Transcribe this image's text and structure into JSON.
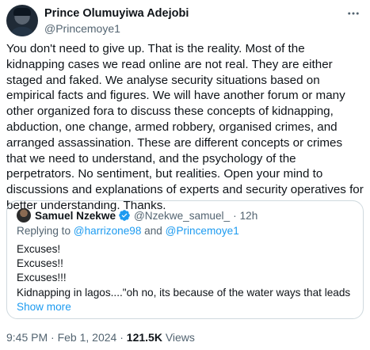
{
  "tweet": {
    "author_name": "Prince Olumuyiwa Adejobi",
    "author_handle": "@Princemoye1",
    "icons": {
      "more": "more-horizontal-icon"
    },
    "text": "You don't need to give up. That is the reality. Most of the kidnapping cases we read online are not real. They are either staged and faked. We analyse security situations based on empirical facts and figures. We will have another forum or many other organized fora to discuss these concepts of kidnapping, abduction, one change, armed robbery, organised crimes, and arranged assassination. These are different concepts or crimes that we need to understand, and the psychology of the perpetrators. No sentiment, but realities. Open your mind to discussions and explanations of experts and security operatives for better understanding. Thanks."
  },
  "quoted": {
    "author_name": "Samuel Nzekwe",
    "author_handle": "@Nzekwe_samuel_",
    "separator": "·",
    "time_ago": "12h",
    "verified_icon": "verified-badge-icon",
    "verified_color": "#1d9bf0",
    "reply_prefix": "Replying to",
    "reply_user_1": "@harrizone98",
    "reply_conjunction": "and",
    "reply_user_2": "@Princemoye1",
    "lines": [
      "Excuses!",
      "Excuses!!",
      "Excuses!!!"
    ],
    "truncated_text": "Kidnapping in lagos....\"oh no, its because of the water ways that leads to ...",
    "show_more": "Show more"
  },
  "footer": {
    "time": "9:45 PM",
    "separator_1": "·",
    "date": "Feb 1, 2024",
    "separator_2": "·",
    "views_count": "121.5K",
    "views_label": "Views"
  },
  "colors": {
    "link": "#1d9bf0",
    "secondary_text": "#536471",
    "primary_text": "#0f1419",
    "border": "#cfd9de"
  }
}
